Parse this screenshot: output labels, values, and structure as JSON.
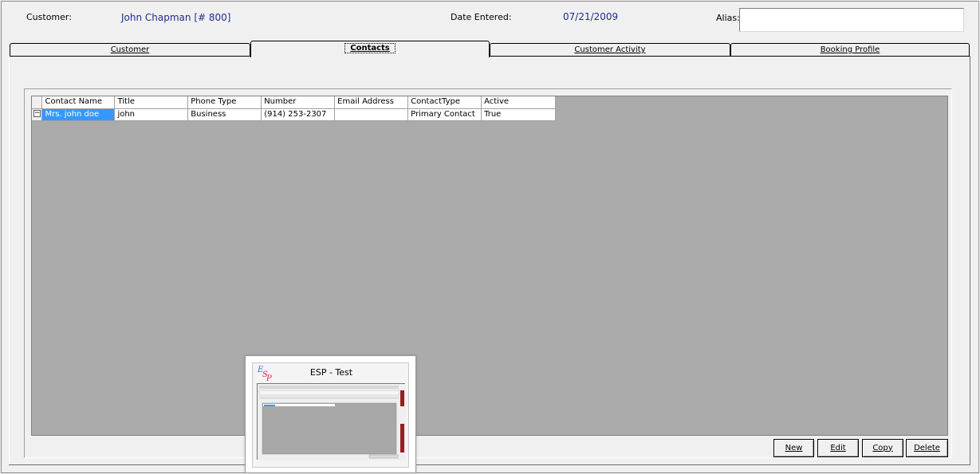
{
  "header": {
    "customer_label": "Customer:",
    "customer_value": "John Chapman [# 800]",
    "date_label": "Date Entered:",
    "date_value": "07/21/2009",
    "alias_label": "Alias:",
    "alias_value": ""
  },
  "tabs": [
    {
      "label": "Customer",
      "active": false
    },
    {
      "label": "Contacts",
      "active": true
    },
    {
      "label": "Customer Activity",
      "active": false
    },
    {
      "label": "Booking Profile",
      "active": false
    }
  ],
  "grid": {
    "columns": [
      "Contact Name",
      "Title",
      "Phone Type",
      "Number",
      "Email Address",
      "ContactType",
      "Active"
    ],
    "rows": [
      {
        "contact_name": "Mrs. john doe",
        "title": "john",
        "phone_type": "Business",
        "number": "(914) 253-2307",
        "email": "",
        "contact_type": "Primary Contact",
        "active": "True"
      }
    ],
    "expander_symbol": "−"
  },
  "buttons": {
    "new": "New",
    "edit": "Edit",
    "copy": "Copy",
    "delete": "Delete"
  },
  "thumbnail": {
    "title": "ESP - Test",
    "logo_text": "ESP"
  },
  "colors": {
    "value_text": "#1f2c8c",
    "selection": "#3399ff",
    "grid_background": "#ababab"
  }
}
